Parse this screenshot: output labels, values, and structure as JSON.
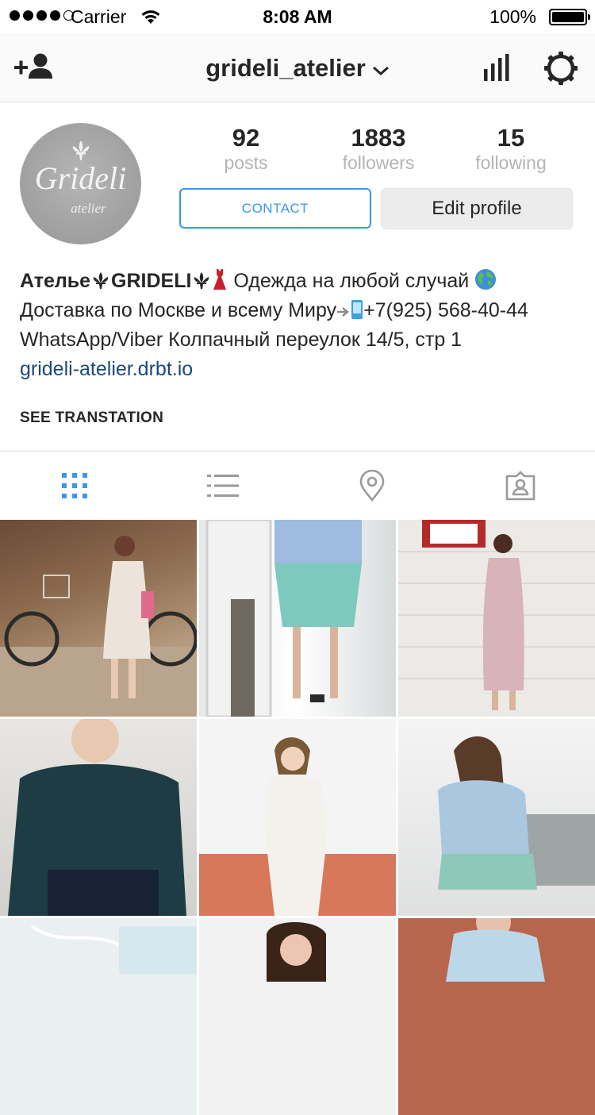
{
  "status_bar": {
    "carrier": "Carrier",
    "time": "8:08 AM",
    "battery": "100%"
  },
  "nav": {
    "username": "grideli_atelier",
    "icons": [
      "add-user-icon",
      "chevron-down-icon",
      "insights-bar-chart-icon",
      "settings-gear-icon"
    ]
  },
  "profile": {
    "avatar": {
      "brand": "Grideli",
      "sub": "atelier"
    },
    "stats": [
      {
        "value": "92",
        "label": "posts"
      },
      {
        "value": "1883",
        "label": "followers"
      },
      {
        "value": "15",
        "label": "following"
      }
    ],
    "contact_label": "CONTACT",
    "edit_label": "Edit profile"
  },
  "bio": {
    "name_part1": "Ателье",
    "name_part2": "GRIDELI",
    "tagline": "Одежда на любой случай",
    "line2_start": "Доставка по Москве и всему Миру",
    "phone": "+7(925) 568-40-44",
    "line3": "WhatsApp/Viber  Колпачный переулок 14/5, стр 1",
    "link": "grideli-atelier.drbt.io"
  },
  "see_translation": "SEE TRANSTATION",
  "tabs": [
    {
      "icon": "grid-icon",
      "active": true
    },
    {
      "icon": "list-icon",
      "active": false
    },
    {
      "icon": "location-pin-icon",
      "active": false
    },
    {
      "icon": "tagged-photos-icon",
      "active": false
    }
  ],
  "colors": {
    "accent": "#3897f0",
    "link": "#1a4a7a",
    "muted": "#b4b4b4"
  }
}
